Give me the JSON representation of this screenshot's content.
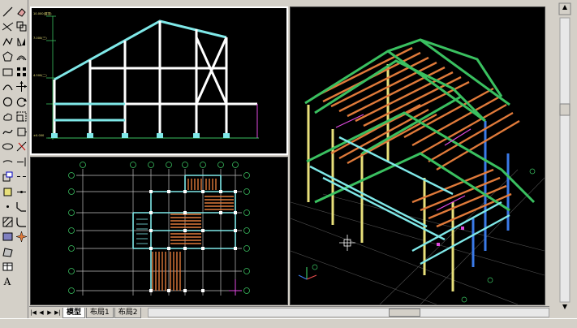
{
  "toolbar": {
    "left_column_icons": [
      "line-icon",
      "construction-line-icon",
      "polyline-icon",
      "polygon-icon",
      "rectangle-icon",
      "arc-icon",
      "circle-icon",
      "revision-cloud-icon",
      "spline-icon",
      "ellipse-icon",
      "ellipse-arc-icon",
      "insert-block-icon",
      "make-block-icon",
      "point-icon",
      "hatch-icon",
      "gradient-icon",
      "region-icon",
      "table-icon",
      "text-icon"
    ],
    "right_column_icons": [
      "erase-icon",
      "copy-icon",
      "mirror-icon",
      "offset-icon",
      "array-icon",
      "move-icon",
      "rotate-icon",
      "scale-icon",
      "stretch-icon",
      "trim-icon",
      "extend-icon",
      "break-icon",
      "join-icon",
      "chamfer-icon",
      "fillet-icon",
      "explode-icon"
    ],
    "text_tool_glyph": "A"
  },
  "elevation_view": {
    "level_labels": [
      "10.000(屋顶)",
      "7.000(三)",
      "4.500(二)",
      "±0.000"
    ]
  },
  "tabs": {
    "model": "模型",
    "layout1": "布局1",
    "layout2": "布局2"
  },
  "nav_buttons": [
    "|◀",
    "◀",
    "▶",
    "▶|"
  ],
  "colors": {
    "viewport_bg": "#000000",
    "elevation_frame": "#ffffff",
    "beam_cyan": "#7fe8e8",
    "steel_orange": "#e07a3a",
    "steel_green": "#3ac060",
    "column_yellow": "#e8e07a",
    "brace_blue": "#3a7ae8",
    "brace_magenta": "#e04ae0",
    "grid_green": "#2e8b2e"
  }
}
